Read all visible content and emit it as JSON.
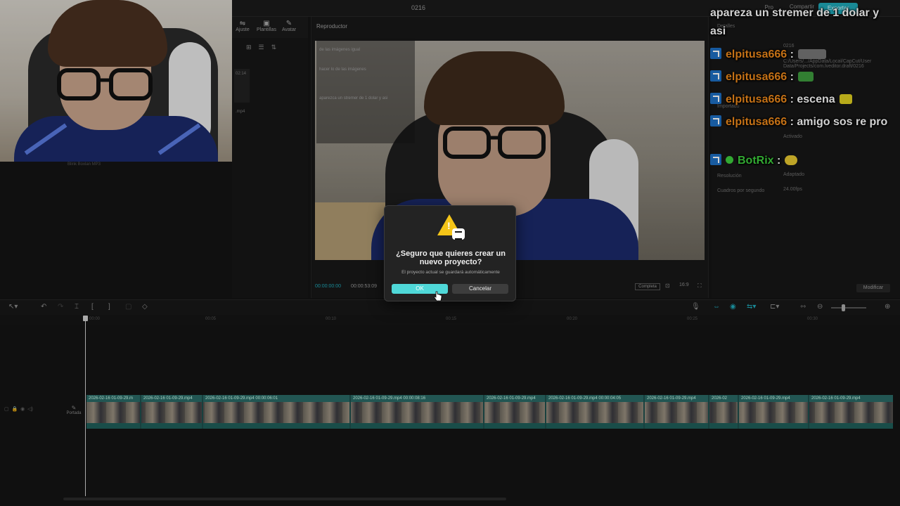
{
  "app": {
    "project_title": "0216",
    "pro_label": "Pro",
    "share_label": "Compartir",
    "export_label": "Exportar"
  },
  "toolbar": {
    "adjust_label": "Ajuste",
    "templates_label": "Plantillas",
    "avatar_label": "Avatar"
  },
  "media": {
    "item_duration": "02:14",
    "item_ext": ".mp4"
  },
  "webcam": {
    "caption": "Blink Boxlan MP3"
  },
  "player": {
    "title": "Reproductor",
    "timecode_current": "00:00:00:00",
    "timecode_total": "00:00:53:09",
    "complete_label": "Completa",
    "ratio_label": "16:9"
  },
  "video_chat": [
    "de las imágenes igual",
    "",
    "hacer lo de las imágenes",
    "",
    "",
    "aparezca un stremer de 1 dolar y asi"
  ],
  "details": {
    "header": "Detalles",
    "name_value": "0216",
    "path_value": "C:/Users/.../AppData/Local/CapCut/User Data/Projects/com.lveditor.draft/0216",
    "importado": "Importado",
    "activated": "Activado",
    "resolution_label": "Resolución",
    "adapted": "Adaptado",
    "fps_label": "Cuadros por segundo",
    "fps_value": "24.00fps",
    "modify_label": "Modificar"
  },
  "chat": {
    "line0": "apareza un stremer de 1 dolar y",
    "line0b": "asi",
    "messages": [
      {
        "user": "elpitusa666",
        "sep": " :",
        "text": ""
      },
      {
        "user": "elpitusa666",
        "sep": " :",
        "text": ""
      },
      {
        "user": "elpitusa666",
        "sep": " :",
        "text": " escena"
      },
      {
        "user": "elpitusa666",
        "sep": " :",
        "text": " amigo sos re pro"
      }
    ],
    "bot": {
      "user": "BotRix",
      "sep": " :",
      "text": ""
    }
  },
  "timeline": {
    "ticks": [
      "00:00",
      "00:05",
      "00:10",
      "00:15",
      "00:20",
      "00:25",
      "00:30"
    ],
    "cover_label": "Portada",
    "clip_labels": [
      "2026-02-16 01-09-29.m",
      "2026-02-16 01-09-29.mp4",
      "2026-02-16 01-09-29.mp4  00:00:06:01",
      "2026-02-16 01-09-29.mp4  00:00:08:16",
      "2026-02-16 01-09-29.mp4",
      "2026-02-16 01-09-29.mp4  00:00:04:05",
      "2026-02-16 01-09-29.mp4",
      "2026-02",
      "2026-02-16 01-09-29.mp4",
      "2026-02-16 01-09-29.mp4"
    ]
  },
  "dialog": {
    "title_line1": "¿Seguro que quieres crear un",
    "title_line2": "nuevo proyecto?",
    "subtitle": "El proyecto actual se guardará automáticamente",
    "ok_label": "OK",
    "cancel_label": "Cancelar"
  },
  "colors": {
    "accent": "#4fd8d8",
    "chat_user": "#f08a1c",
    "chat_bot": "#3ecf3e"
  }
}
